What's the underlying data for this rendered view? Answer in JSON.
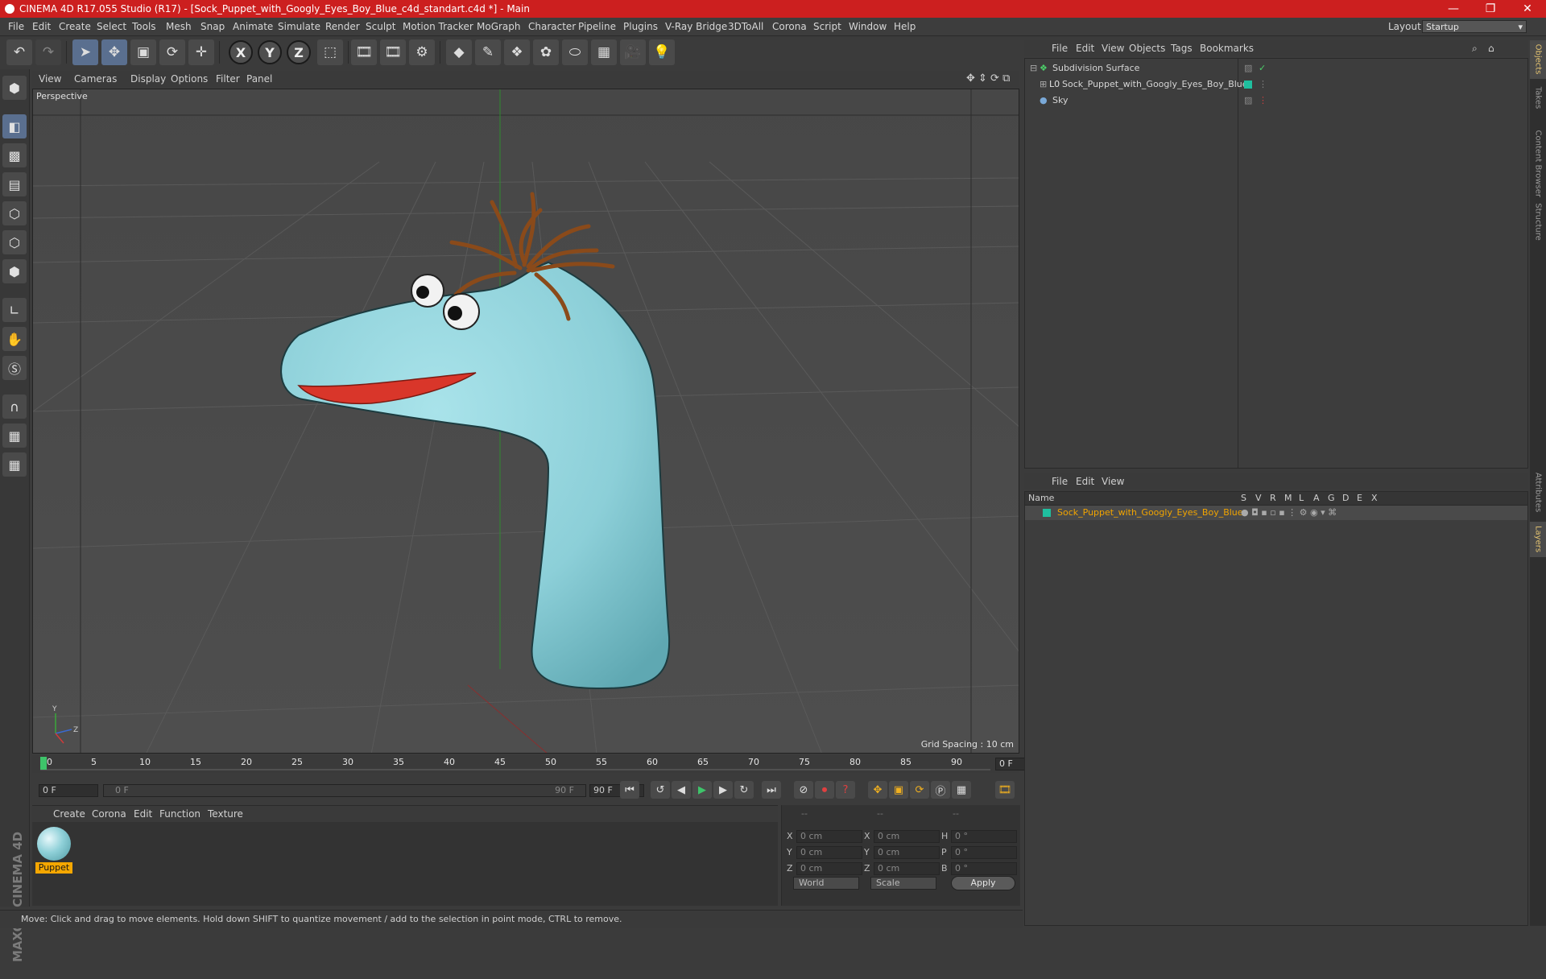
{
  "window": {
    "title": "CINEMA 4D R17.055 Studio (R17) - [Sock_Puppet_with_Googly_Eyes_Boy_Blue_c4d_standart.c4d *] - Main",
    "minimize": "—",
    "restore": "❐",
    "close": "✕"
  },
  "menubar": {
    "items": [
      "File",
      "Edit",
      "Create",
      "Select",
      "Tools",
      "Mesh",
      "Snap",
      "Animate",
      "Simulate",
      "Render",
      "Sculpt",
      "Motion Tracker",
      "MoGraph",
      "Character",
      "Pipeline",
      "Plugins",
      "V-Ray Bridge",
      "3DToAll",
      "Corona",
      "Script",
      "Window",
      "Help"
    ],
    "layout_label": "Layout:",
    "layout_value": "Startup"
  },
  "viewport": {
    "menu": [
      "View",
      "Cameras",
      "Display",
      "Options",
      "Filter",
      "Panel"
    ],
    "label": "Perspective",
    "grid_spacing": "Grid Spacing : 10 cm"
  },
  "timeline": {
    "ticks": [
      "0",
      "5",
      "10",
      "15",
      "20",
      "25",
      "30",
      "35",
      "40",
      "45",
      "50",
      "55",
      "60",
      "65",
      "70",
      "75",
      "80",
      "85",
      "90"
    ],
    "current_frame": "0 F"
  },
  "transport": {
    "start_field": "0 F",
    "range_start": "0 F",
    "range_end": "90 F",
    "end_field": "90 F"
  },
  "materials": {
    "menu": [
      "Create",
      "Corona",
      "Edit",
      "Function",
      "Texture"
    ],
    "items": [
      {
        "name": "Puppet"
      }
    ]
  },
  "coordinates": {
    "headers": [
      "--",
      "--",
      "--"
    ],
    "rows": [
      {
        "l1": "X",
        "v1": "0 cm",
        "l2": "X",
        "v2": "0 cm",
        "l3": "H",
        "v3": "0 °"
      },
      {
        "l1": "Y",
        "v1": "0 cm",
        "l2": "Y",
        "v2": "0 cm",
        "l3": "P",
        "v3": "0 °"
      },
      {
        "l1": "Z",
        "v1": "0 cm",
        "l2": "Z",
        "v2": "0 cm",
        "l3": "B",
        "v3": "0 °"
      }
    ],
    "mode": "World",
    "scale": "Scale",
    "apply": "Apply"
  },
  "status": {
    "text": "Move: Click and drag to move elements. Hold down SHIFT to quantize movement / add to the selection in point mode, CTRL to remove."
  },
  "objects": {
    "menu": [
      "File",
      "Edit",
      "View",
      "Objects",
      "Tags",
      "Bookmarks"
    ],
    "items": [
      {
        "name": "Subdivision Surface"
      },
      {
        "name": "Sock_Puppet_with_Googly_Eyes_Boy_Blue"
      },
      {
        "name": "Sky"
      }
    ]
  },
  "layers": {
    "menu": [
      "File",
      "Edit",
      "View"
    ],
    "columns": [
      "Name",
      "S",
      "V",
      "R",
      "M",
      "L",
      "A",
      "G",
      "D",
      "E",
      "X"
    ],
    "items": [
      {
        "name": "Sock_Puppet_with_Googly_Eyes_Boy_Blue"
      }
    ]
  },
  "right_tabs": [
    "Objects",
    "Takes",
    "Content Browser",
    "Structure",
    "Attributes",
    "Layers"
  ],
  "colors": {
    "titlebar": "#cc1f1f",
    "accent_orange": "#f1a400",
    "layer_color": "#1fbf9f",
    "sock": "#8fd0d8"
  }
}
